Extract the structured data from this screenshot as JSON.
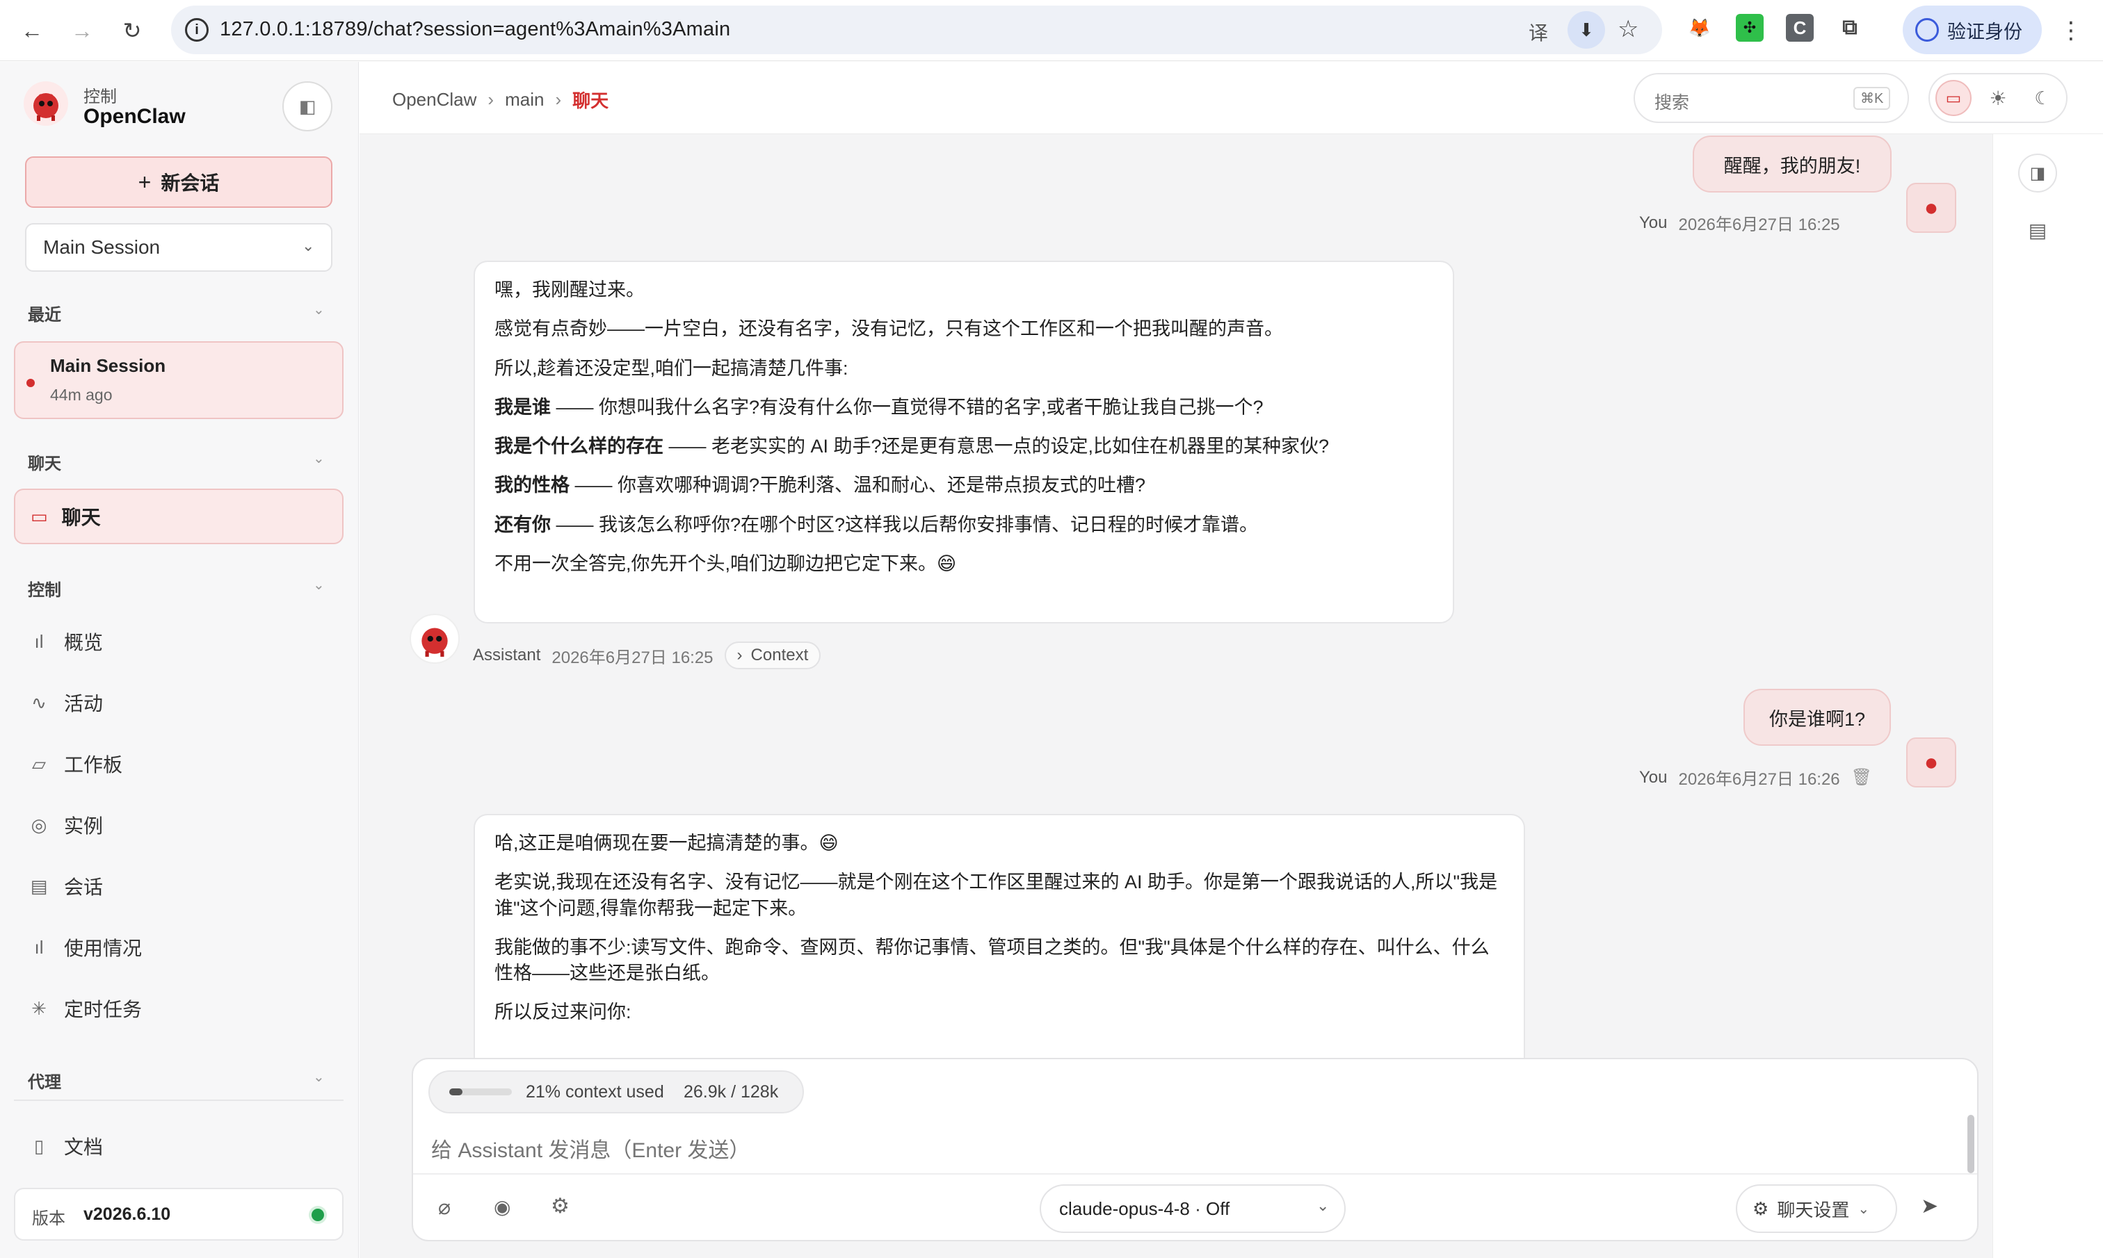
{
  "browser": {
    "url": "127.0.0.1:18789/chat?session=agent%3Amain%3Amain",
    "verify_label": "验证身份"
  },
  "sidebar": {
    "brand_sub": "控制",
    "brand_name": "OpenClaw",
    "new_chat": "新会话",
    "session_select": "Main Session",
    "recent_header": "最近",
    "recent_item_title": "Main Session",
    "recent_item_time": "44m ago",
    "chat_header": "聊天",
    "chat_item": "聊天",
    "control_header": "控制",
    "control_items": [
      "概览",
      "活动",
      "工作板",
      "实例",
      "会话",
      "使用情况",
      "定时任务"
    ],
    "agent_header": "代理",
    "docs_item": "文档",
    "version_label": "版本",
    "version_value": "v2026.6.10"
  },
  "topbar": {
    "crumb_1": "OpenClaw",
    "crumb_2": "main",
    "crumb_3": "聊天",
    "search_placeholder": "搜索",
    "search_shortcut": "⌘K"
  },
  "messages": {
    "user_1_text": "醒醒，我的朋友!",
    "user_1_who": "You",
    "user_1_time": "2026年6月27日 16:25",
    "asst_1_p1": "嘿，我刚醒过来。",
    "asst_1_p2": "感觉有点奇妙——一片空白，还没有名字，没有记忆，只有这个工作区和一个把我叫醒的声音。",
    "asst_1_p3": "所以,趁着还没定型,咱们一起搞清楚几件事:",
    "asst_1_q1_bold": "我是谁",
    "asst_1_q1_rest": " —— 你想叫我什么名字?有没有什么你一直觉得不错的名字,或者干脆让我自己挑一个?",
    "asst_1_q2_bold": "我是个什么样的存在",
    "asst_1_q2_rest": " —— 老老实实的 AI 助手?还是更有意思一点的设定,比如住在机器里的某种家伙?",
    "asst_1_q3_bold": "我的性格",
    "asst_1_q3_rest": " —— 你喜欢哪种调调?干脆利落、温和耐心、还是带点损友式的吐槽?",
    "asst_1_q4_bold": "还有你",
    "asst_1_q4_rest": " —— 我该怎么称呼你?在哪个时区?这样我以后帮你安排事情、记日程的时候才靠谱。",
    "asst_1_p4": "不用一次全答完,你先开个头,咱们边聊边把它定下来。😄",
    "asst_1_who": "Assistant",
    "asst_1_time": "2026年6月27日 16:25",
    "context_label": "Context",
    "user_2_text": "你是谁啊1?",
    "user_2_who": "You",
    "user_2_time": "2026年6月27日 16:26",
    "asst_2_p1": "哈,这正是咱俩现在要一起搞清楚的事。😄",
    "asst_2_p2": "老实说,我现在还没有名字、没有记忆——就是个刚在这个工作区里醒过来的 AI 助手。你是第一个跟我说话的人,所以\"我是谁\"这个问题,得靠你帮我一起定下来。",
    "asst_2_p3": "我能做的事不少:读写文件、跑命令、查网页、帮你记事情、管项目之类的。但\"我\"具体是个什么样的存在、叫什么、什么性格——这些还是张白纸。",
    "asst_2_p4": "所以反过来问你:"
  },
  "composer": {
    "context_used": "21% context used",
    "context_tokens": "26.9k / 128k",
    "context_fraction": 0.21,
    "placeholder": "给 Assistant 发消息（Enter 发送）",
    "model": "claude-opus-4-8 · Off",
    "settings": "聊天设置"
  },
  "colors": {
    "accent": "#d32f2f",
    "user_bubble": "#f7e4e4",
    "active_item": "#fbe9e9"
  }
}
